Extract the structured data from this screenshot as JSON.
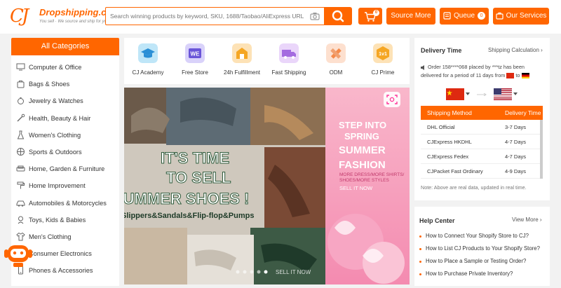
{
  "header": {
    "logo_mark": "CJ",
    "logo_name": "Dropshipping.com",
    "logo_tagline": "You sell · We source and ship for you!",
    "search_placeholder": "Search winning products by keyword, SKU, 1688/Taobao/AliExpress URL",
    "cart_count": "0",
    "source_more": "Source More",
    "queue": "Queue",
    "queue_count": "0",
    "our_services": "Our Services"
  },
  "categories": {
    "title": "All Categories",
    "items": [
      {
        "label": "Computer & Office",
        "icon": "computer-icon"
      },
      {
        "label": "Bags & Shoes",
        "icon": "bag-icon"
      },
      {
        "label": "Jewelry & Watches",
        "icon": "ring-icon"
      },
      {
        "label": "Health, Beauty & Hair",
        "icon": "brush-icon"
      },
      {
        "label": "Women's Clothing",
        "icon": "dress-icon"
      },
      {
        "label": "Sports & Outdoors",
        "icon": "ball-icon"
      },
      {
        "label": "Home, Garden & Furniture",
        "icon": "sofa-icon"
      },
      {
        "label": "Home Improvement",
        "icon": "roller-icon"
      },
      {
        "label": "Automobiles & Motorcycles",
        "icon": "car-icon"
      },
      {
        "label": "Toys, Kids & Babies",
        "icon": "toy-icon"
      },
      {
        "label": "Men's Clothing",
        "icon": "shirt-icon"
      },
      {
        "label": "Consumer Electronics",
        "icon": "camera-icon"
      },
      {
        "label": "Phones & Accessories",
        "icon": "phone-icon"
      }
    ]
  },
  "features": [
    {
      "label": "CJ Academy",
      "color": "#5ab8e6"
    },
    {
      "label": "Free Store",
      "color": "#7c6be0"
    },
    {
      "label": "24h Fulfillment",
      "color": "#f5a623"
    },
    {
      "label": "Fast Shipping",
      "color": "#a46be0"
    },
    {
      "label": "ODM",
      "color": "#f58a4a"
    },
    {
      "label": "CJ Prime",
      "color": "#f5a623"
    }
  ],
  "banner": {
    "left_line1": "IT'S TIME",
    "left_line2": "TO SELL",
    "left_line3": "SUMMER SHOES !",
    "left_sub": "Slippers&Sandals&Flip-flop&Pumps",
    "right_line1": "STEP INTO",
    "right_line2": "SPRING",
    "right_line3": "SUMMER",
    "right_line4": "FASHION",
    "right_sub1": "MORE DRESS/MORE SHIRTS/",
    "right_sub2": "SHOES/MORE STYLES",
    "right_cta": "SELL IT NOW",
    "bottom_cta": "SELL IT NOW"
  },
  "delivery": {
    "title": "Delivery Time",
    "link": "Shipping Calculation",
    "order_text": "Order 158****068 placed by ***tz has been delivered for a period of 11 days from",
    "to_text": "to",
    "col_method": "Shipping Method",
    "col_time": "Delivery Time",
    "rows": [
      {
        "method": "DHL Official",
        "time": "3-7 Days"
      },
      {
        "method": "CJExpress HKDHL",
        "time": "4-7 Days"
      },
      {
        "method": "CJExpress Fedex",
        "time": "4-7 Days"
      },
      {
        "method": "CJPacket Fast Ordinary",
        "time": "4-9 Days"
      }
    ],
    "note": "Note: Above are real data, updated in real time."
  },
  "help": {
    "title": "Help Center",
    "link": "View More",
    "items": [
      "How to Connect Your Shopify Store to CJ?",
      "How to List CJ Products to Your Shopify Store?",
      "How to Place a Sample or Testing Order?",
      "How to Purchase Private Inventory?"
    ]
  },
  "colors": {
    "brand": "#ff6600"
  }
}
